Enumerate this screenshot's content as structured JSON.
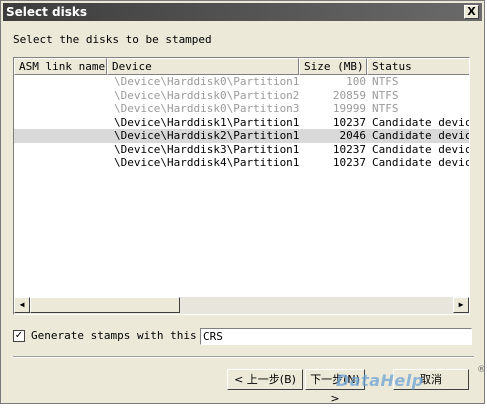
{
  "window": {
    "title": "Select disks",
    "close_glyph": "X"
  },
  "instruction": "Select the disks to be stamped",
  "table": {
    "columns": [
      "ASM link name",
      "Device",
      "Size (MB)",
      "Status"
    ],
    "rows": [
      {
        "asm": "",
        "device": "\\Device\\Harddisk0\\Partition1",
        "size": "100",
        "status": "NTFS",
        "state": "disabled"
      },
      {
        "asm": "",
        "device": "\\Device\\Harddisk0\\Partition2",
        "size": "20859",
        "status": "NTFS",
        "state": "disabled"
      },
      {
        "asm": "",
        "device": "\\Device\\Harddisk0\\Partition3",
        "size": "19999",
        "status": "NTFS",
        "state": "disabled"
      },
      {
        "asm": "",
        "device": "\\Device\\Harddisk1\\Partition1",
        "size": "10237",
        "status": "Candidate device",
        "state": "normal"
      },
      {
        "asm": "",
        "device": "\\Device\\Harddisk2\\Partition1",
        "size": "2046",
        "status": "Candidate device",
        "state": "selected"
      },
      {
        "asm": "",
        "device": "\\Device\\Harddisk3\\Partition1",
        "size": "10237",
        "status": "Candidate device",
        "state": "normal"
      },
      {
        "asm": "",
        "device": "\\Device\\Harddisk4\\Partition1",
        "size": "10237",
        "status": "Candidate device",
        "state": "normal"
      }
    ]
  },
  "scroll": {
    "left_arrow": "◀",
    "right_arrow": "▶"
  },
  "stamps": {
    "checked": true,
    "check_glyph": "✓",
    "label": "Generate stamps with this p",
    "value": "CRS"
  },
  "buttons": {
    "back": "< 上一步(B)",
    "next": "下一步(N) >",
    "cancel": "取消"
  },
  "watermark": {
    "text": "DataHelp",
    "mark": "®"
  }
}
